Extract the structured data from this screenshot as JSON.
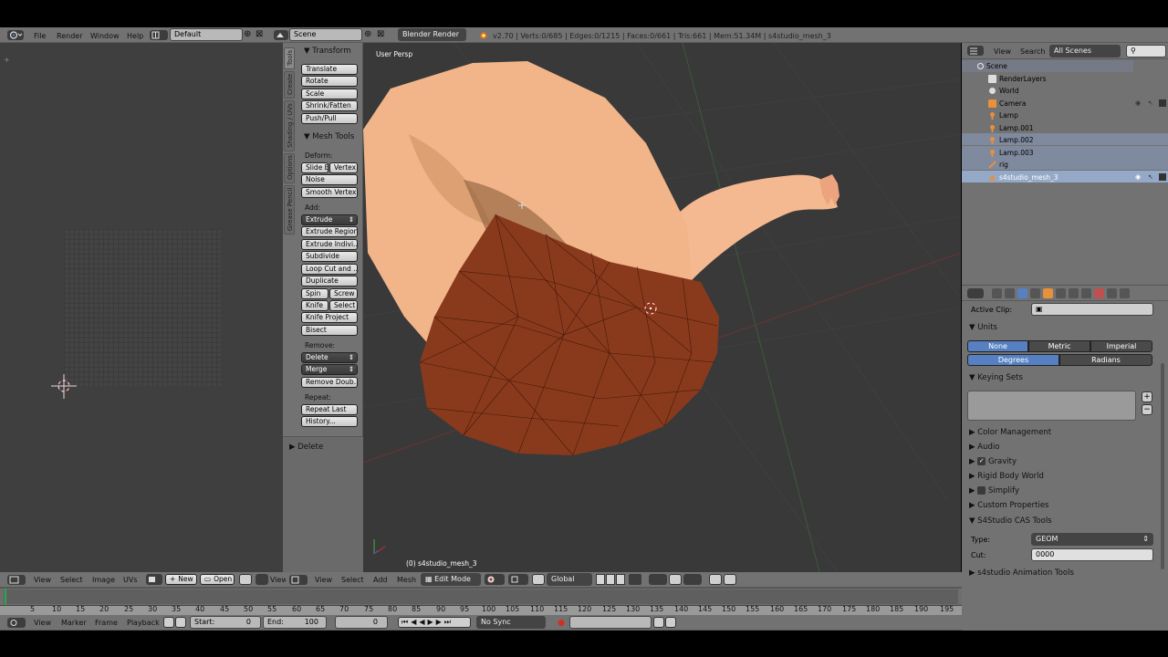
{
  "top_bar": {
    "menus": [
      "File",
      "Render",
      "Window",
      "Help"
    ],
    "layout_value": "Default",
    "scene_value": "Scene",
    "engine_value": "Blender Render",
    "stats": "v2.70 | Verts:0/685 | Edges:0/1215 | Faces:0/661 | Tris:661 | Mem:51.34M | s4studio_mesh_3"
  },
  "tool_shelf": {
    "tabs": [
      "Tools",
      "Create",
      "Shading / UVs",
      "Options",
      "Grease Pencil"
    ],
    "transform_title": "Transform",
    "transform_buttons": [
      "Translate",
      "Rotate",
      "Scale",
      "Shrink/Fatten",
      "Push/Pull"
    ],
    "mesh_tools_title": "Mesh Tools",
    "deform_label": "Deform:",
    "slide_e": "Slide E",
    "vertex": "Vertex",
    "noise": "Noise",
    "smooth_vertex": "Smooth Vertex",
    "add_label": "Add:",
    "extrude": "Extrude",
    "extrude_region": "Extrude Region",
    "extrude_indiv": "Extrude Indivi...",
    "subdivide": "Subdivide",
    "loop_cut": "Loop Cut and ...",
    "duplicate": "Duplicate",
    "spin": "Spin",
    "screw": "Screw",
    "knife": "Knife",
    "select": "Select",
    "knife_project": "Knife Project",
    "bisect": "Bisect",
    "remove_label": "Remove:",
    "delete": "Delete",
    "merge": "Merge",
    "remove_doubles": "Remove Doub...",
    "repeat_label": "Repeat:",
    "repeat_last": "Repeat Last",
    "history": "History...",
    "operator_panel": "Delete"
  },
  "viewport": {
    "view_label": "User Persp",
    "object_label": "(0) s4studio_mesh_3",
    "menus": [
      "View",
      "Select",
      "Add",
      "Mesh"
    ],
    "mode": "Edit Mode",
    "orientation": "Global"
  },
  "image_editor": {
    "menus": [
      "View",
      "Select",
      "Image",
      "UVs"
    ],
    "new_label": "New",
    "open_label": "Open",
    "view_label": "View"
  },
  "timeline": {
    "ticks": [
      "5",
      "10",
      "15",
      "20",
      "25",
      "30",
      "35",
      "40",
      "45",
      "50",
      "55",
      "60",
      "65",
      "70",
      "75",
      "80",
      "85",
      "90",
      "95",
      "100",
      "105",
      "110",
      "115",
      "120",
      "125",
      "130",
      "135",
      "140",
      "145",
      "150",
      "155",
      "160",
      "165",
      "170",
      "175",
      "180",
      "185",
      "190",
      "195"
    ],
    "menus": [
      "View",
      "Marker",
      "Frame",
      "Playback"
    ],
    "start_label": "Start:",
    "start_value": "0",
    "end_label": "End:",
    "end_value": "100",
    "current_frame": "0",
    "sync": "No Sync"
  },
  "outliner": {
    "menus": [
      "View",
      "Search"
    ],
    "scope": "All Scenes",
    "items": [
      {
        "label": "Scene"
      },
      {
        "label": "RenderLayers"
      },
      {
        "label": "World"
      },
      {
        "label": "Camera"
      },
      {
        "label": "Lamp"
      },
      {
        "label": "Lamp.001"
      },
      {
        "label": "Lamp.002"
      },
      {
        "label": "Lamp.003"
      },
      {
        "label": "rig"
      },
      {
        "label": "s4studio_mesh_3"
      }
    ]
  },
  "properties": {
    "active_clip_label": "Active Clip:",
    "units_title": "Units",
    "unit_systems": [
      "None",
      "Metric",
      "Imperial"
    ],
    "rotation_units": [
      "Degrees",
      "Radians"
    ],
    "keying_sets_title": "Keying Sets",
    "color_management": "Color Management",
    "audio": "Audio",
    "gravity": "Gravity",
    "rigid_body_world": "Rigid Body World",
    "simplify": "Simplify",
    "custom_properties": "Custom Properties",
    "cas_tools_title": "S4Studio CAS Tools",
    "type_label": "Type:",
    "type_value": "GEOM",
    "cut_label": "Cut:",
    "cut_value": "0000",
    "animation_tools": "s4studio Animation Tools"
  },
  "colors": {
    "header_bg": "#727272",
    "panel_bg": "#727272",
    "viewport_bg": "#393939",
    "selected_blue": "#5680c2",
    "mesh_red": "#8a3a1c",
    "skin": "#f2b58a"
  }
}
